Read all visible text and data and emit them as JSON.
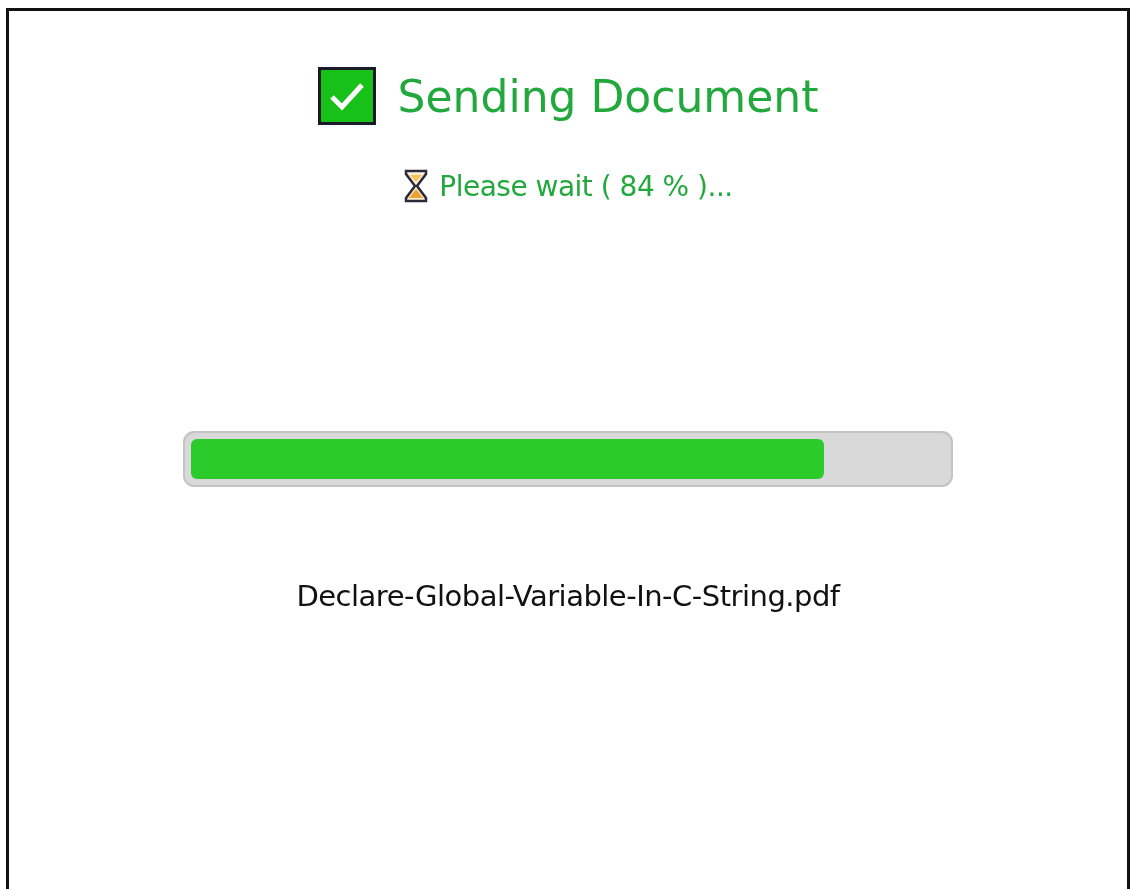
{
  "dialog": {
    "title": "Sending Document",
    "status": "Please wait ( 84 % )...",
    "progress": {
      "level": 0.84
    },
    "file_name": "Declare-Global-Variable-In-C-String.pdf"
  }
}
